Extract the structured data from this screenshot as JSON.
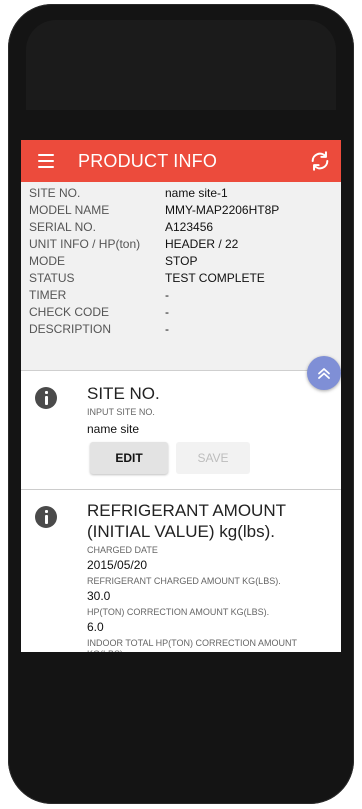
{
  "appbar": {
    "title": "PRODUCT INFO",
    "menu_icon": "hamburger-menu-icon",
    "sync_icon": "sync-icon",
    "accent_color": "#ec4b3c"
  },
  "info": [
    {
      "label": "SITE NO.",
      "value": "name site-1"
    },
    {
      "label": "MODEL NAME",
      "value": "MMY-MAP2206HT8P"
    },
    {
      "label": "SERIAL NO.",
      "value": "A123456"
    },
    {
      "label": "UNIT INFO / HP(ton)",
      "value": "HEADER / 22"
    },
    {
      "label": "MODE",
      "value": "STOP"
    },
    {
      "label": "STATUS",
      "value": "TEST COMPLETE"
    },
    {
      "label": "TIMER",
      "value": "-"
    },
    {
      "label": "CHECK CODE",
      "value": "-"
    },
    {
      "label": "DESCRIPTION",
      "value": "-"
    }
  ],
  "site_section": {
    "title": "SITE NO.",
    "input_label": "INPUT SITE NO.",
    "input_value": "name site",
    "edit_label": "EDIT",
    "save_label": "SAVE"
  },
  "refrigerant_section": {
    "title": "REFRIGERANT AMOUNT (INITIAL VALUE) kg(lbs).",
    "charged_date_label": "CHARGED DATE",
    "charged_date": "2015/05/20",
    "charged_amount_label": "REFRIGERANT CHARGED AMOUNT kg(lbs).",
    "charged_amount": "30.0",
    "hp_correction_label": "HP(ton) CORRECTION AMOUNT kg(lbs).",
    "hp_correction": "6.0",
    "indoor_total_label": "INDOOR TOTAL HP(ton) CORRECTION AMOUNT kg(lbs)."
  }
}
